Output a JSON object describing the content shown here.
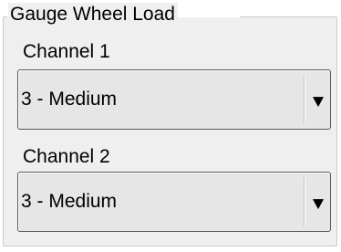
{
  "group": {
    "title": "Gauge Wheel Load"
  },
  "channels": [
    {
      "label": "Channel 1",
      "selected": "3 - Medium",
      "dropdown_icon": "triangle-down-icon"
    },
    {
      "label": "Channel 2",
      "selected": "3 - Medium",
      "dropdown_icon": "triangle-down-icon"
    }
  ],
  "colors": {
    "group_background": "#efefef",
    "dropdown_background": "#e6e6e6",
    "dropdown_border": "#5a5a5a",
    "text": "#000000"
  }
}
